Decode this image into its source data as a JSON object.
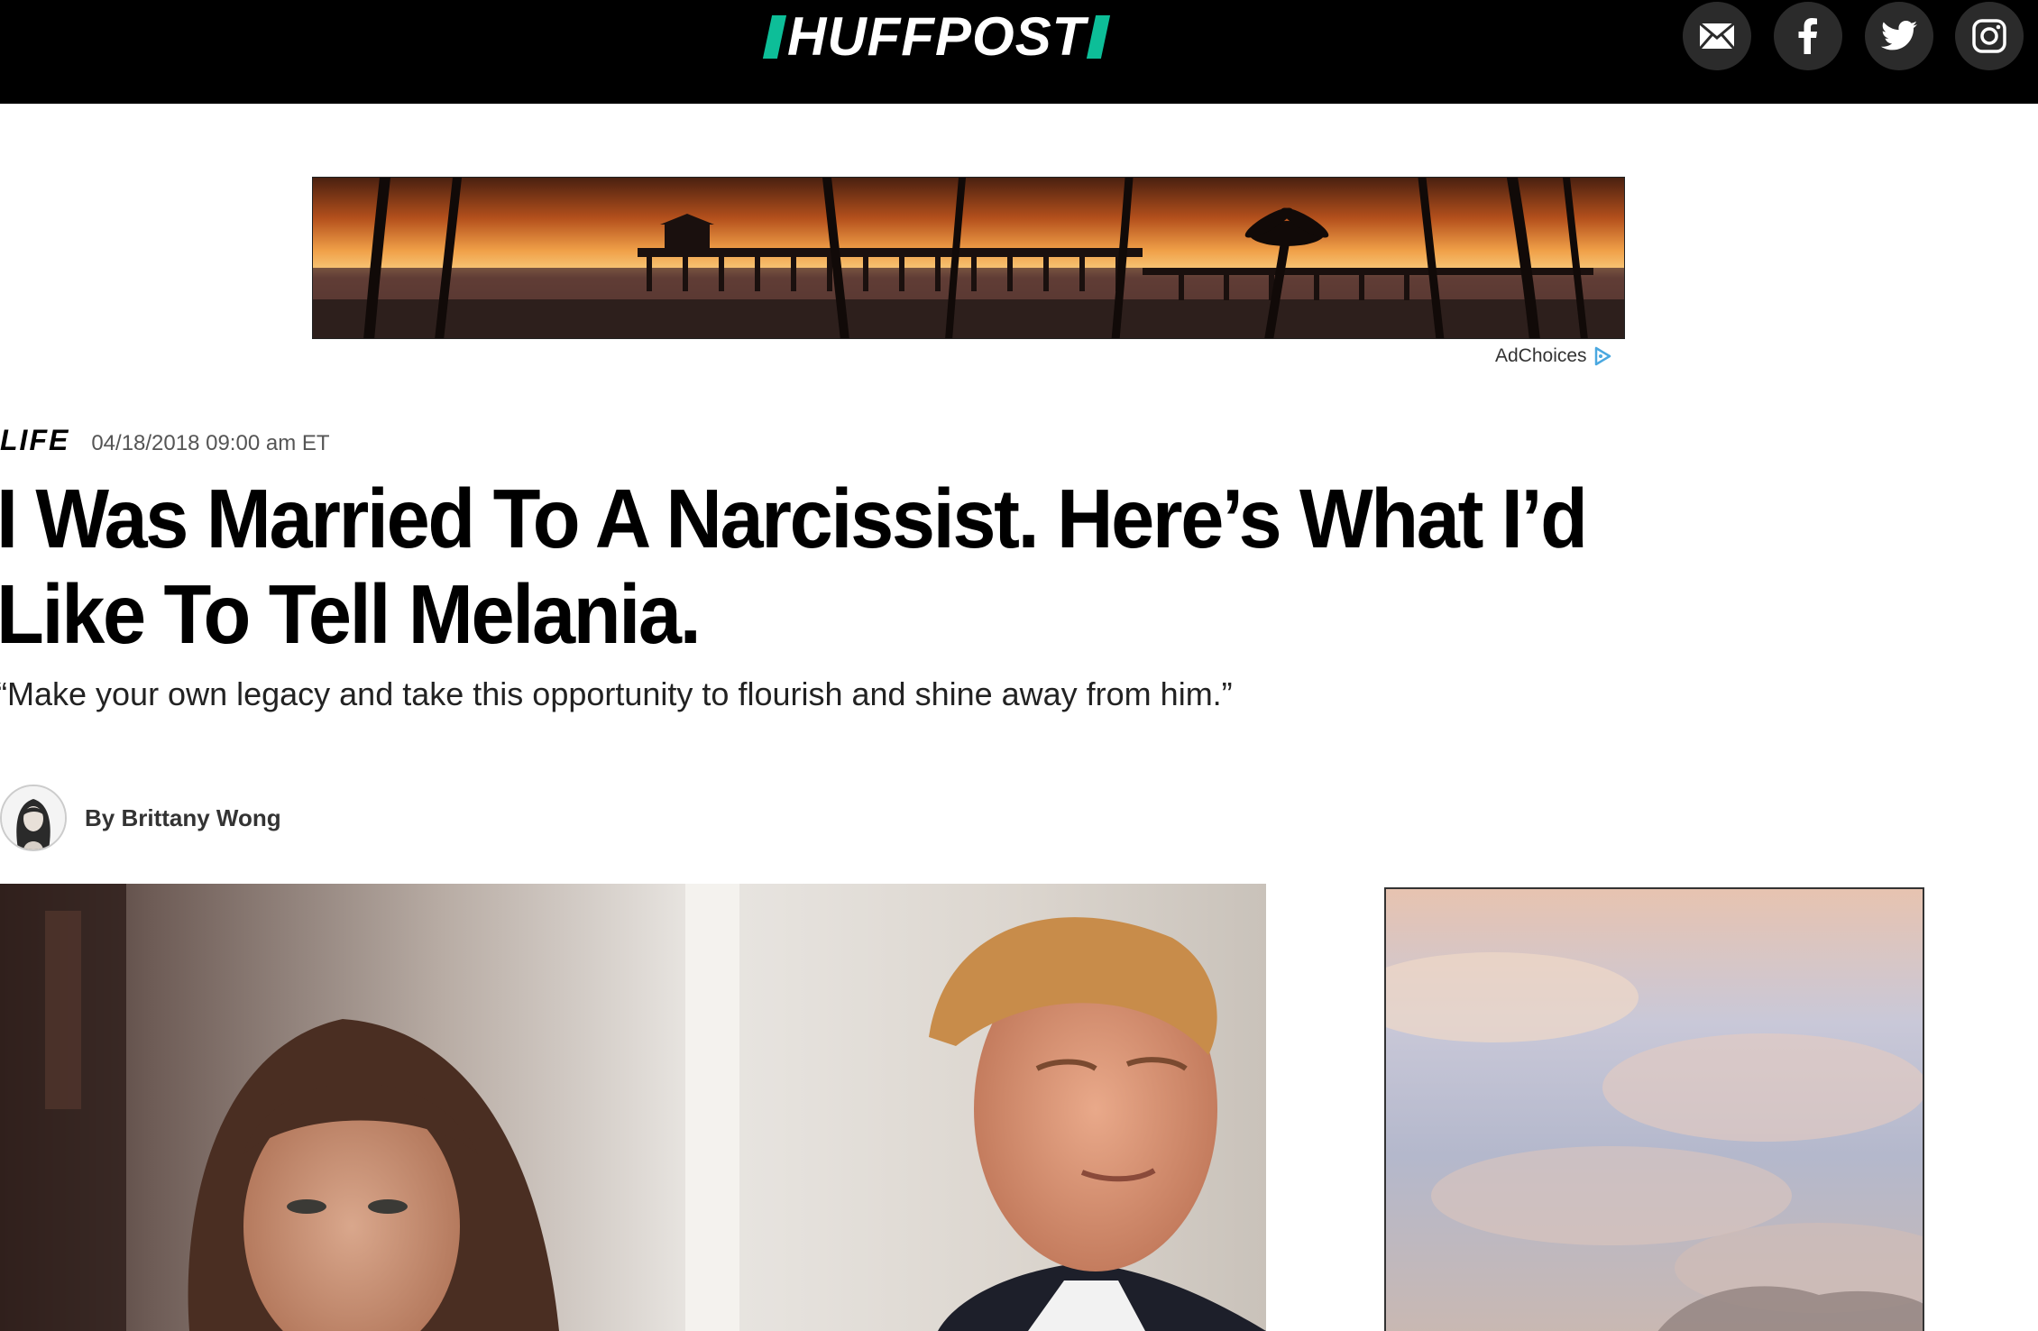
{
  "header": {
    "logo_text": "HUFFPOST",
    "brand_color": "#0dbe98",
    "social": [
      {
        "name": "email-icon",
        "label": "Email"
      },
      {
        "name": "facebook-icon",
        "label": "Facebook"
      },
      {
        "name": "twitter-icon",
        "label": "Twitter"
      },
      {
        "name": "instagram-icon",
        "label": "Instagram"
      }
    ]
  },
  "ad": {
    "adchoices_label": "AdChoices"
  },
  "article": {
    "section": "LIFE",
    "timestamp": "04/18/2018 09:00 am ET",
    "headline": "I Was Married To A Narcissist. Here’s What I’d Like To Tell Melania.",
    "dek": "“Make your own legacy and take this opportunity to flourish and shine away from him.”",
    "byline": "By Brittany Wong"
  }
}
